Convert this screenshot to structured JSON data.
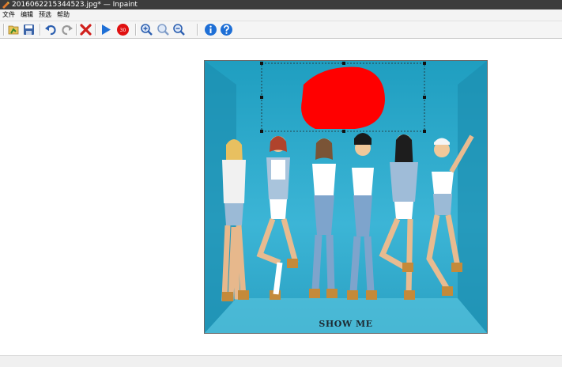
{
  "window": {
    "title": "2016062215344523.jpg* — Inpaint",
    "titlebar_color": "#3c3c3c"
  },
  "menu": {
    "items": [
      "文件",
      "编辑",
      "预选",
      "帮助"
    ]
  },
  "toolbar": {
    "buttons": [
      {
        "name": "open-icon",
        "color": "#3a8a2c"
      },
      {
        "name": "save-icon",
        "color": "#3b64a8"
      },
      {
        "name": "undo-icon",
        "color": "#2c5fb0"
      },
      {
        "name": "redo-icon",
        "color": "#9a9a9a"
      },
      {
        "name": "clear-icon",
        "color": "#d0201c"
      },
      {
        "name": "run-icon",
        "color": "#1e6fd6"
      },
      {
        "name": "stop-icon",
        "color": "#e01010"
      },
      {
        "name": "zoom-in-icon",
        "color": "#2c5fb0"
      },
      {
        "name": "zoom-actual-icon",
        "color": "#2c5fb0"
      },
      {
        "name": "zoom-out-icon",
        "color": "#2c5fb0"
      },
      {
        "name": "info-icon",
        "color": "#1e6fd6"
      },
      {
        "name": "help-icon",
        "color": "#1e6fd6"
      }
    ],
    "stop_badge": "30"
  },
  "image": {
    "caption": "SHOW ME",
    "background_color": "#2aa8c8",
    "mask_color": "#ff0000"
  }
}
